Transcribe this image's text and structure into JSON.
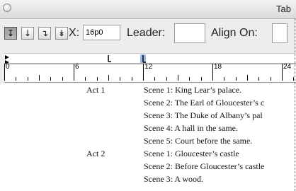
{
  "window": {
    "title": "Tab"
  },
  "toolbar": {
    "tab_buttons": [
      {
        "glyph": "↧",
        "name": "left-justified-tab",
        "selected": true
      },
      {
        "glyph": "↓",
        "name": "center-justified-tab",
        "selected": false
      },
      {
        "glyph": "↴",
        "name": "right-justified-tab",
        "selected": false
      },
      {
        "glyph": "↡",
        "name": "align-to-decimal-tab",
        "selected": false
      }
    ],
    "x_label": "X:",
    "x_value": "16p0",
    "leader_label": "Leader:",
    "leader_value": "",
    "align_on_label": "Align On:",
    "align_on_value": ""
  },
  "ruler": {
    "numbers": [
      "0",
      "6",
      "12",
      "18",
      "24"
    ]
  },
  "document": {
    "rows": [
      {
        "act": "Act 1",
        "scene": "Scene 1: King Lear’s palace."
      },
      {
        "act": "",
        "scene": "Scene 2: The Earl of Gloucester’s c"
      },
      {
        "act": "",
        "scene": "Scene 3: The Duke of Albany’s pal"
      },
      {
        "act": "",
        "scene": "Scene 4: A hall in the same."
      },
      {
        "act": "",
        "scene": "Scene 5: Court before the same."
      },
      {
        "act": "Act 2",
        "scene": "Scene 1: Gloucester’s castle"
      },
      {
        "act": "",
        "scene": "Scene 2: Before Gloucester’s castle"
      },
      {
        "act": "",
        "scene": "Scene 3: A wood."
      }
    ]
  }
}
